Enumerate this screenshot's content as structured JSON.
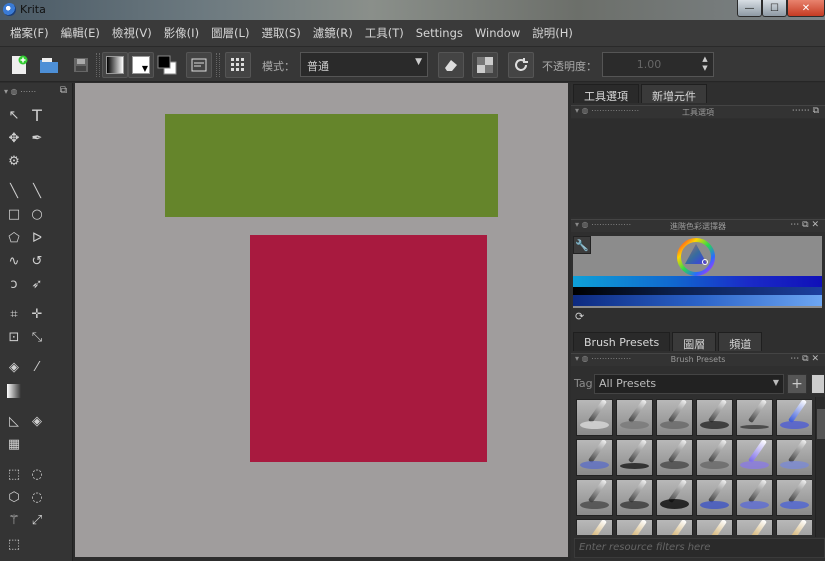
{
  "window": {
    "title": "Krita",
    "min": "—",
    "max": "☐",
    "close": "✕"
  },
  "menu": {
    "items": [
      "檔案(F)",
      "編輯(E)",
      "檢視(V)",
      "影像(I)",
      "圖層(L)",
      "選取(S)",
      "濾鏡(R)",
      "工具(T)",
      "Settings",
      "Window",
      "說明(H)"
    ]
  },
  "toolbar": {
    "blend_mode_label": "模式：",
    "blend_mode_value": "普通",
    "opacity_label": "不透明度：",
    "opacity_value": "1.00"
  },
  "canvas": {
    "shapes": [
      {
        "name": "green-rectangle",
        "color": "#65852b"
      },
      {
        "name": "red-rectangle",
        "color": "#a81a3f"
      }
    ]
  },
  "dock": {
    "top_tabs": [
      "工具選項",
      "新增元件"
    ],
    "tool_options_title": "工具選項",
    "color_selector_title": "進階色彩選擇器",
    "bottom_tabs": [
      "Brush Presets",
      "圖層",
      "頻道"
    ],
    "brush_presets_title": "Brush Presets",
    "tag_label": "Tag",
    "tag_value": "All Presets",
    "filter_placeholder": "Enter resource filters here"
  },
  "colors": {
    "canvas_bg": "#a09d9d",
    "green": "#65852b",
    "red": "#a81a3f",
    "ui_dark": "#2d2d2d"
  }
}
